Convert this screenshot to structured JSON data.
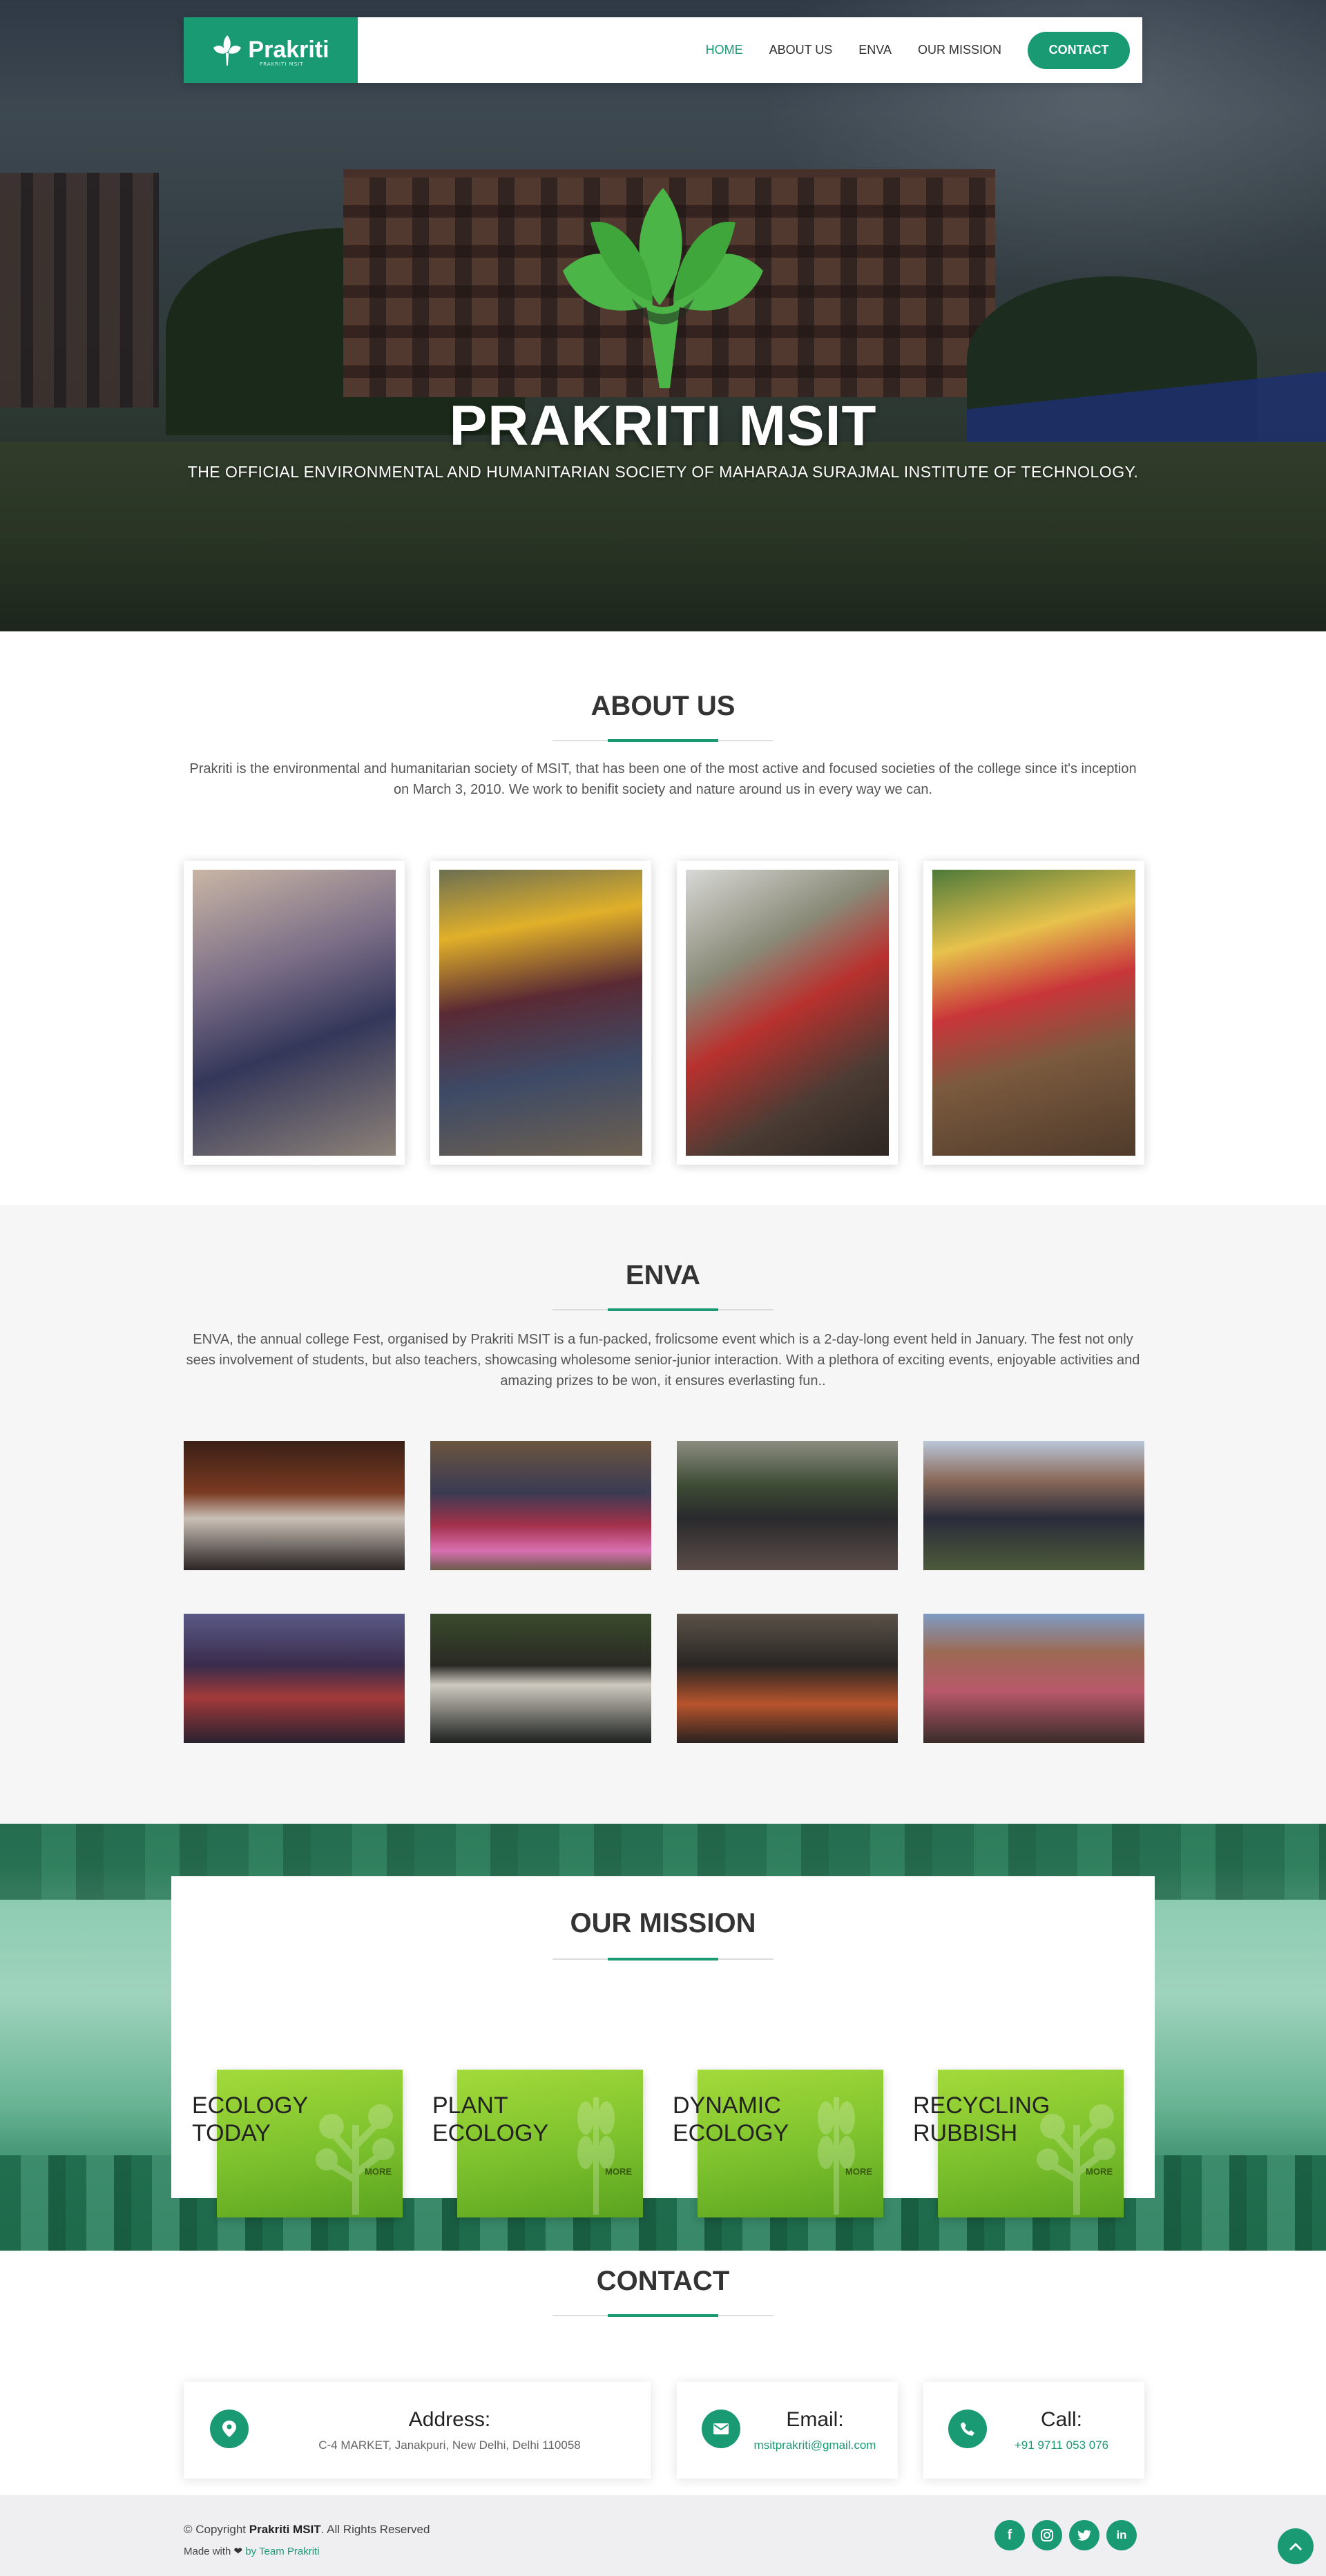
{
  "nav": {
    "brand": "Prakriti",
    "brand_tagline": "PRAKRITI MSIT",
    "links": [
      "HOME",
      "ABOUT US",
      "ENVA",
      "OUR MISSION"
    ],
    "cta": "CONTACT"
  },
  "hero": {
    "title": "PRAKRITI MSIT",
    "subtitle": "THE OFFICIAL ENVIRONMENTAL AND HUMANITARIAN SOCIETY OF MAHARAJA SURAJMAL INSTITUTE OF TECHNOLOGY."
  },
  "about": {
    "title": "ABOUT US",
    "text": "Prakriti is the environmental and humanitarian society of MSIT, that has been one of the most active and focused societies of the college since it's inception on March 3, 2010. We work to benifit society and nature around us in every way we can."
  },
  "enva": {
    "title": "ENVA",
    "text": "ENVA, the annual college Fest, organised by Prakriti MSIT is a fun-packed, frolicsome event which is a 2-day-long event held in January. The fest not only sees involvement of students, but also teachers, showcasing wholesome senior-junior interaction. With a plethora of exciting events, enjoyable activities and amazing prizes to be won, it ensures everlasting fun.."
  },
  "mission": {
    "title": "OUR MISSION",
    "cards": [
      {
        "line1": "ECOLOGY",
        "line2": "TODAY",
        "more": "MORE"
      },
      {
        "line1": "PLANT",
        "line2": "ECOLOGY",
        "more": "MORE"
      },
      {
        "line1": "DYNAMIC",
        "line2": "ECOLOGY",
        "more": "MORE"
      },
      {
        "line1": "RECYCLING",
        "line2": "RUBBISH",
        "more": "MORE"
      }
    ]
  },
  "contact": {
    "title": "CONTACT",
    "address_label": "Address:",
    "address_value": "C-4 MARKET, Janakpuri, New Delhi, Delhi 110058",
    "email_label": "Email:",
    "email_value": "msitprakriti@gmail.com",
    "call_label": "Call:",
    "call_value": "+91 9711 053 076"
  },
  "footer": {
    "copyright_prefix": "© Copyright",
    "copyright_name": "Prakriti MSIT",
    "copyright_suffix": ". All Rights Reserved",
    "made_with": "Made with",
    "made_by": "by Team Prakriti"
  },
  "icons": {
    "address": "map-marker-icon",
    "email": "envelope-icon",
    "call": "phone-icon",
    "social": [
      "facebook-icon",
      "instagram-icon",
      "twitter-icon",
      "linkedin-icon"
    ],
    "back_to_top": "chevron-up-icon"
  },
  "colors": {
    "accent": "#1a9a73",
    "mission_card": "#7cc12d",
    "section_alt_bg": "#f6f6f6"
  }
}
